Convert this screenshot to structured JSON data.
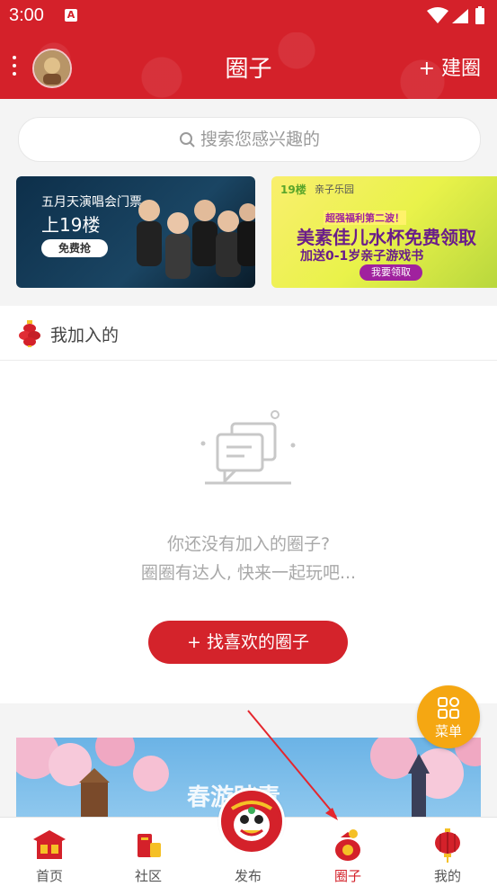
{
  "status_bar": {
    "time": "3:00",
    "badge": "A"
  },
  "header": {
    "title": "圈子",
    "build_label": "+ 建圈"
  },
  "search": {
    "placeholder": "搜索您感兴趣的"
  },
  "banners": [
    {
      "line1": "五月天演唱会门票",
      "line2": "上19楼",
      "button": "免费抢"
    },
    {
      "logo": "19楼",
      "brand": "亲子乐园",
      "sub": "超强福利第二波！",
      "headline": "美素佳儿水杯免费领取",
      "line2": "加送0-1岁亲子游戏书",
      "button": "我要领取"
    }
  ],
  "joined_section": {
    "title": "我加入的",
    "empty_line1": "你还没有加入的圈子?",
    "empty_line2": "圈圈有达人, 快来一起玩吧...",
    "find_button": "+ 找喜欢的圈子"
  },
  "bottom_banner": {
    "caption": "春游踏青"
  },
  "fab": {
    "label": "菜单"
  },
  "tabs": [
    {
      "label": "首页",
      "icon": "home-icon"
    },
    {
      "label": "社区",
      "icon": "community-icon"
    },
    {
      "label": "发布",
      "icon": "publish-icon"
    },
    {
      "label": "圈子",
      "icon": "circle-icon"
    },
    {
      "label": "我的",
      "icon": "profile-icon"
    }
  ],
  "colors": {
    "primary": "#d4212a",
    "fab": "#f5a712"
  }
}
